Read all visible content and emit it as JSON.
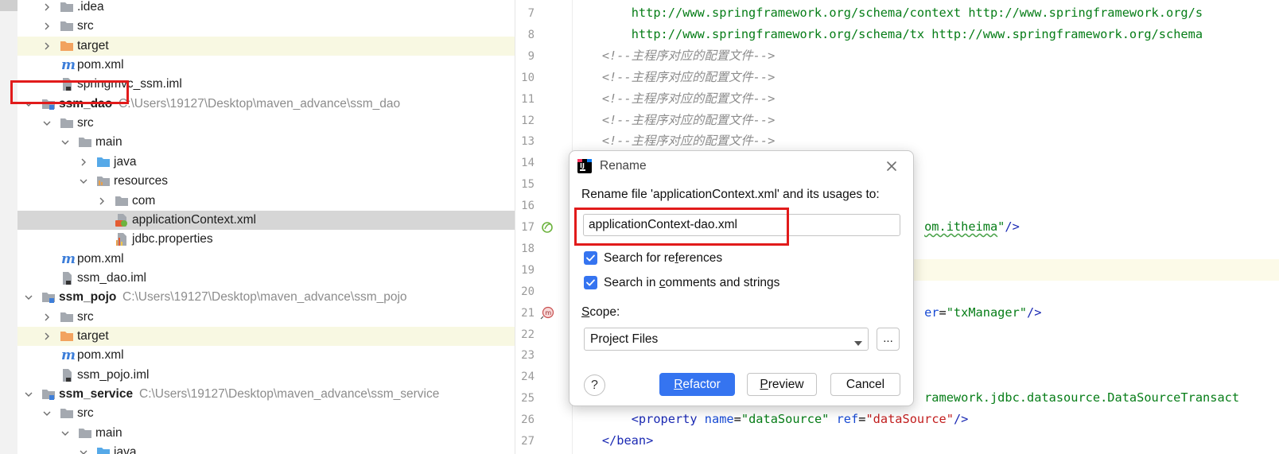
{
  "project_tree": {
    "rows": [
      {
        "label": ".idea",
        "kind": "folder",
        "indent": 1,
        "expanded": false
      },
      {
        "label": "src",
        "kind": "folder",
        "indent": 1,
        "expanded": false
      },
      {
        "label": "target",
        "kind": "folder-orange",
        "indent": 1,
        "expanded": false
      },
      {
        "label": "pom.xml",
        "kind": "maven",
        "indent": 1
      },
      {
        "label": "springmvc_ssm.iml",
        "kind": "iml",
        "indent": 1
      },
      {
        "label": "ssm_dao",
        "path": "C:\\Users\\19127\\Desktop\\maven_advance\\ssm_dao",
        "kind": "module",
        "indent": 0,
        "expanded": true
      },
      {
        "label": "src",
        "kind": "folder",
        "indent": 1,
        "expanded": true
      },
      {
        "label": "main",
        "kind": "folder",
        "indent": 2,
        "expanded": true
      },
      {
        "label": "java",
        "kind": "folder-blue",
        "indent": 3,
        "expanded": false
      },
      {
        "label": "resources",
        "kind": "folder-res",
        "indent": 3,
        "expanded": true
      },
      {
        "label": "com",
        "kind": "folder",
        "indent": 4,
        "expanded": false
      },
      {
        "label": "applicationContext.xml",
        "kind": "spring-xml",
        "indent": 4,
        "selected": true
      },
      {
        "label": "jdbc.properties",
        "kind": "properties",
        "indent": 4
      },
      {
        "label": "pom.xml",
        "kind": "maven",
        "indent": 1
      },
      {
        "label": "ssm_dao.iml",
        "kind": "iml",
        "indent": 1
      },
      {
        "label": "ssm_pojo",
        "path": "C:\\Users\\19127\\Desktop\\maven_advance\\ssm_pojo",
        "kind": "module",
        "indent": 0,
        "expanded": true
      },
      {
        "label": "src",
        "kind": "folder",
        "indent": 1,
        "expanded": false
      },
      {
        "label": "target",
        "kind": "folder-orange",
        "indent": 1,
        "expanded": false
      },
      {
        "label": "pom.xml",
        "kind": "maven",
        "indent": 1
      },
      {
        "label": "ssm_pojo.iml",
        "kind": "iml",
        "indent": 1
      },
      {
        "label": "ssm_service",
        "path": "C:\\Users\\19127\\Desktop\\maven_advance\\ssm_service",
        "kind": "module",
        "indent": 0,
        "expanded": true
      },
      {
        "label": "src",
        "kind": "folder",
        "indent": 1,
        "expanded": true
      },
      {
        "label": "main",
        "kind": "folder",
        "indent": 2,
        "expanded": true
      },
      {
        "label": "java",
        "kind": "folder-blue",
        "indent": 3,
        "expanded": true
      }
    ]
  },
  "editor": {
    "current_line": 19,
    "lines": [
      {
        "n": "7",
        "parts": [
          {
            "t": "        ",
            "c": ""
          },
          {
            "t": "http://www.springframework.org/schema/context http://www.springframework.org/s",
            "c": "c-url"
          }
        ]
      },
      {
        "n": "8",
        "parts": [
          {
            "t": "        ",
            "c": ""
          },
          {
            "t": "http://www.springframework.org/schema/tx http://www.springframework.org/schema",
            "c": "c-url"
          }
        ]
      },
      {
        "n": "9",
        "parts": [
          {
            "t": "    ",
            "c": ""
          },
          {
            "t": "<!--主程序对应的配置文件-->",
            "c": "c-com"
          }
        ]
      },
      {
        "n": "10",
        "parts": [
          {
            "t": "    ",
            "c": ""
          },
          {
            "t": "<!--主程序对应的配置文件-->",
            "c": "c-com"
          }
        ]
      },
      {
        "n": "11",
        "parts": [
          {
            "t": "    ",
            "c": ""
          },
          {
            "t": "<!--主程序对应的配置文件-->",
            "c": "c-com"
          }
        ]
      },
      {
        "n": "12",
        "parts": [
          {
            "t": "    ",
            "c": ""
          },
          {
            "t": "<!--主程序对应的配置文件-->",
            "c": "c-com"
          }
        ]
      },
      {
        "n": "13",
        "parts": [
          {
            "t": "    ",
            "c": ""
          },
          {
            "t": "<!--主程序对应的配置文件-->",
            "c": "c-com"
          }
        ]
      },
      {
        "n": "14",
        "parts": []
      },
      {
        "n": "15",
        "parts": []
      },
      {
        "n": "16",
        "parts": []
      },
      {
        "n": "17",
        "parts": [
          {
            "t": "                                                ",
            "c": ""
          },
          {
            "t": "om.itheima",
            "c": "c-val c-und"
          },
          {
            "t": "\"",
            "c": "c-val"
          },
          {
            "t": "/>",
            "c": "c-tag"
          }
        ],
        "gutter_icon": "spring-bean-icon"
      },
      {
        "n": "18",
        "parts": []
      },
      {
        "n": "19",
        "parts": []
      },
      {
        "n": "20",
        "parts": []
      },
      {
        "n": "21",
        "parts": [
          {
            "t": "                                                ",
            "c": ""
          },
          {
            "t": "er",
            "c": "c-attr"
          },
          {
            "t": "=",
            "c": ""
          },
          {
            "t": "\"txManager\"",
            "c": "c-val"
          },
          {
            "t": "/>",
            "c": "c-tag"
          }
        ],
        "gutter_icon": "method-icon"
      },
      {
        "n": "22",
        "parts": []
      },
      {
        "n": "23",
        "parts": []
      },
      {
        "n": "24",
        "parts": []
      },
      {
        "n": "25",
        "parts": [
          {
            "t": "                                                ",
            "c": ""
          },
          {
            "t": "ramework.jdbc.datasource.DataSourceTransact",
            "c": "c-val"
          }
        ]
      },
      {
        "n": "26",
        "parts": [
          {
            "t": "        ",
            "c": ""
          },
          {
            "t": "<property ",
            "c": "c-tag"
          },
          {
            "t": "name",
            "c": "c-attr"
          },
          {
            "t": "=",
            "c": ""
          },
          {
            "t": "\"dataSource\"",
            "c": "c-val"
          },
          {
            "t": " ",
            "c": ""
          },
          {
            "t": "ref",
            "c": "c-attr"
          },
          {
            "t": "=",
            "c": ""
          },
          {
            "t": "\"dataSource\"",
            "c": "c-red"
          },
          {
            "t": "/>",
            "c": "c-tag"
          }
        ]
      },
      {
        "n": "27",
        "parts": [
          {
            "t": "    ",
            "c": ""
          },
          {
            "t": "</bean>",
            "c": "c-tag"
          }
        ]
      }
    ]
  },
  "dialog": {
    "title": "Rename",
    "message": "Rename file 'applicationContext.xml' and its usages to:",
    "input_value": "applicationContext-dao.xml",
    "search_references": {
      "pre": "Search for re",
      "mn": "f",
      "post": "erences",
      "checked": true
    },
    "search_comments": {
      "pre": "Search in ",
      "mn": "c",
      "post": "omments and strings",
      "checked": true
    },
    "scope_label": {
      "pre": "",
      "mn": "S",
      "post": "cope:"
    },
    "scope_value": "Project Files",
    "more_button": "...",
    "help_button": "?",
    "refactor_button": {
      "pre": "",
      "mn": "R",
      "post": "efactor"
    },
    "preview_button": {
      "pre": "",
      "mn": "P",
      "post": "review"
    },
    "cancel_button": "Cancel"
  },
  "colors": {
    "accent": "#3574f0",
    "annotation_red": "#e11b1b",
    "selection": "#d6d6d6",
    "excluded_folder": "#f8f8e2"
  }
}
